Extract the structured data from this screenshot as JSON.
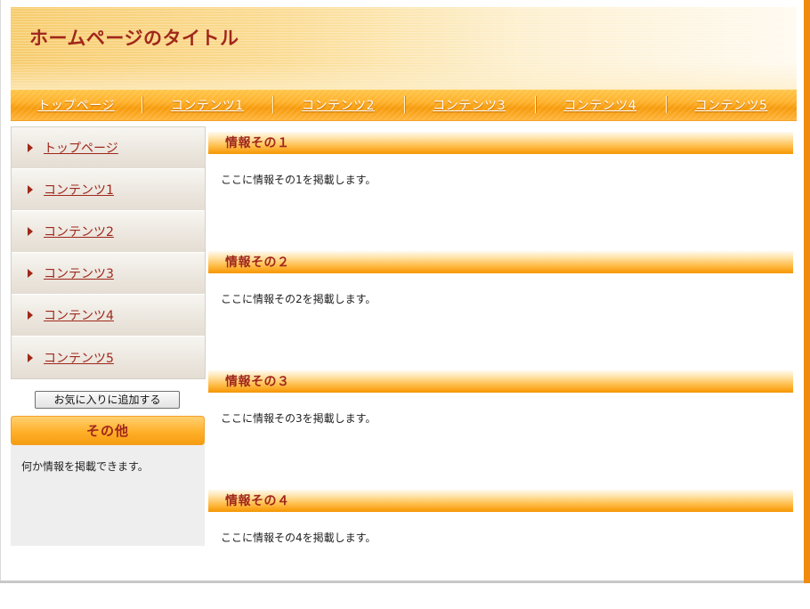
{
  "header": {
    "title": "ホームページのタイトル"
  },
  "topnav": {
    "items": [
      "トップページ",
      "コンテンツ1",
      "コンテンツ2",
      "コンテンツ3",
      "コンテンツ4",
      "コンテンツ5"
    ]
  },
  "sidebar": {
    "items": [
      "トップページ",
      "コンテンツ1",
      "コンテンツ2",
      "コンテンツ3",
      "コンテンツ4",
      "コンテンツ5"
    ],
    "favorite_button": "お気に入りに追加する",
    "other": {
      "heading": "その他",
      "text": "何か情報を掲載できます。"
    }
  },
  "main": {
    "sections": [
      {
        "heading": "情報その１",
        "text": "ここに情報その1を掲載します。"
      },
      {
        "heading": "情報その２",
        "text": "ここに情報その2を掲載します。"
      },
      {
        "heading": "情報その３",
        "text": "ここに情報その3を掲載します。"
      },
      {
        "heading": "情報その４",
        "text": "ここに情報その4を掲載します。"
      }
    ]
  },
  "colors": {
    "accent_orange": "#f08a10",
    "title_red": "#a0281c",
    "nav_orange": "#ffb12a"
  }
}
